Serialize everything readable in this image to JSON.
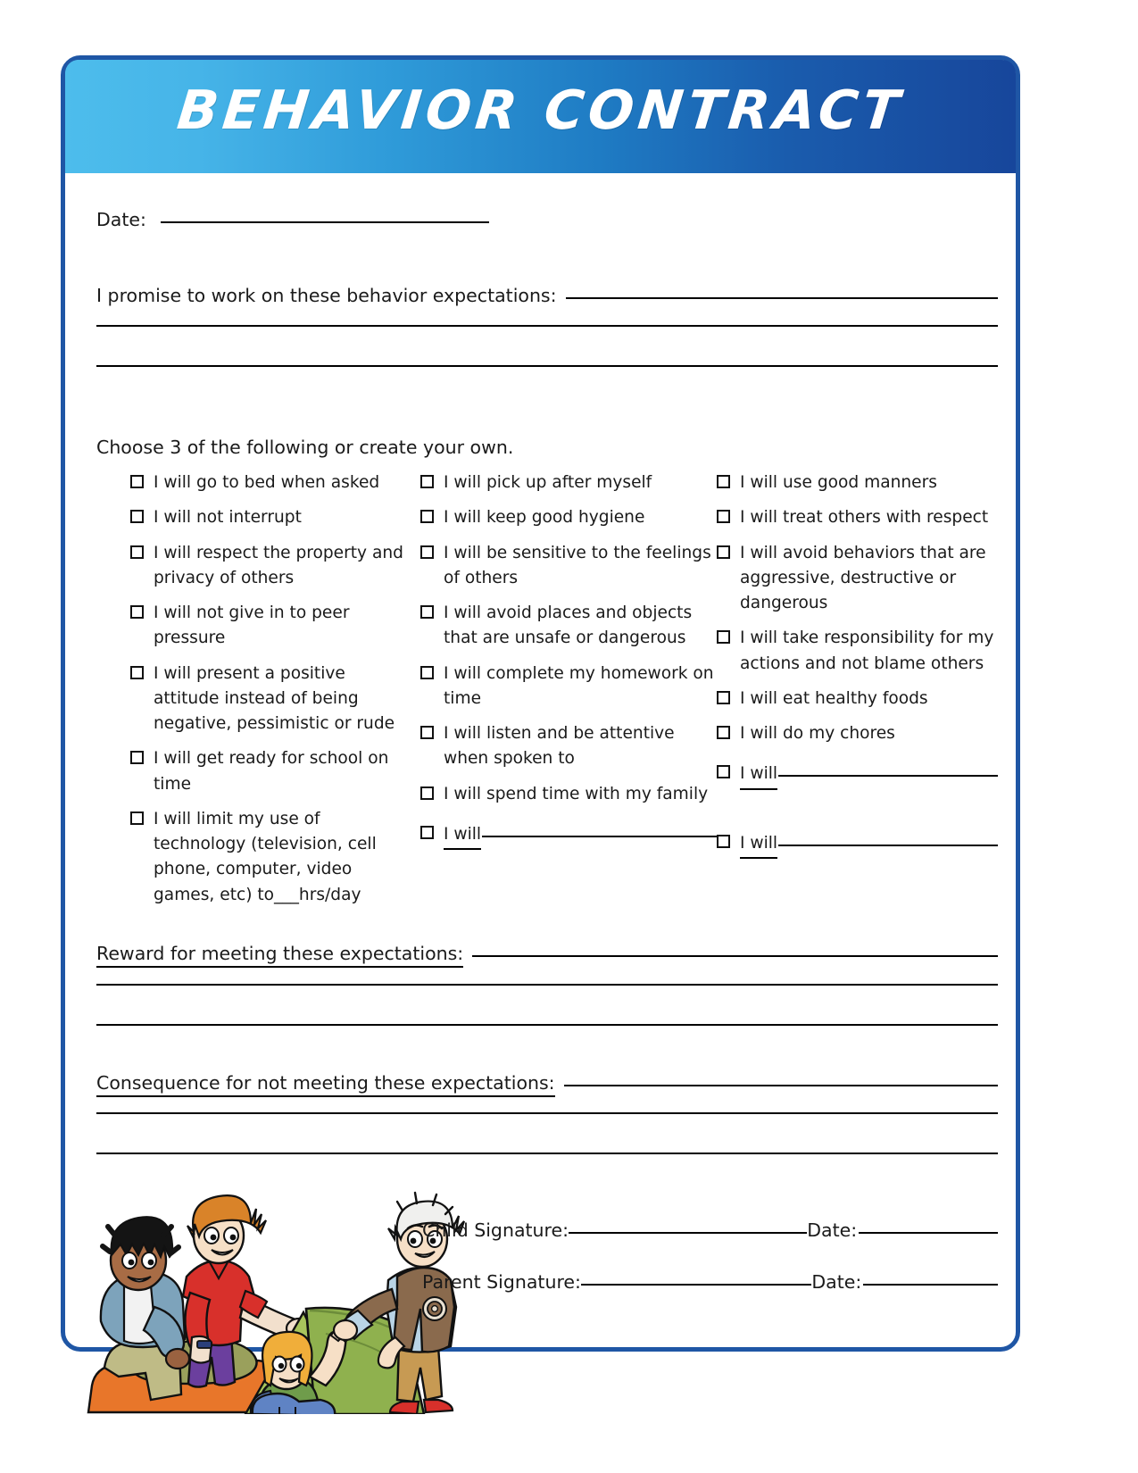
{
  "document": {
    "title": "BEHAVIOR CONTRACT"
  },
  "fields": {
    "date_label": "Date:",
    "promise_label": "I promise to work on these behavior  expectations:",
    "choose_label": "Choose 3 of the following or create your  own.",
    "reward_label": "Reward for meeting these  expectations:",
    "consequence_label": "Consequence for not meeting these   expectations:"
  },
  "checklist": {
    "column1": [
      {
        "text": "I will go to bed when asked"
      },
      {
        "text": "I will not interrupt"
      },
      {
        "text": "I will respect the property and privacy of others"
      },
      {
        "text": "I will not give in to peer pressure"
      },
      {
        "text": "I will present a positive attitude instead of being negative, pessimistic or rude"
      },
      {
        "text": "I will get ready for school on time"
      },
      {
        "text": "I will limit my use of technology (television, cell phone, computer, video games, etc) to___hrs/day"
      }
    ],
    "column2": [
      {
        "text": "I will pick up after myself"
      },
      {
        "text": "I will keep good hygiene"
      },
      {
        "text": "I will be sensitive to the feelings of others"
      },
      {
        "text": "I will avoid places and objects that are unsafe or dangerous"
      },
      {
        "text": "I will complete my homework on time"
      },
      {
        "text": "I will listen and be attentive when spoken to"
      },
      {
        "text": "I will spend time with my family"
      }
    ],
    "column2_blank": {
      "text": "I will"
    },
    "column3": [
      {
        "text": "I will use good manners"
      },
      {
        "text": "I will treat others with respect"
      },
      {
        "text": "I will avoid behaviors that are aggressive, destructive or dangerous"
      },
      {
        "text": "I will take responsibility for my actions and not blame others"
      },
      {
        "text": "I will eat healthy foods"
      },
      {
        "text": "I will do my chores"
      }
    ],
    "column3_blank_1": {
      "text": "I will"
    },
    "column3_blank_2": {
      "text": "I will"
    }
  },
  "signatures": {
    "child_label": "Child  Signature:",
    "child_date_label": "Date:",
    "parent_label": "Parent Signature:",
    "parent_date_label": "Date:"
  },
  "colors": {
    "border": "#1f56a5",
    "header_light": "#4dbdec",
    "header_dark": "#17469b",
    "rule": "#000000"
  }
}
